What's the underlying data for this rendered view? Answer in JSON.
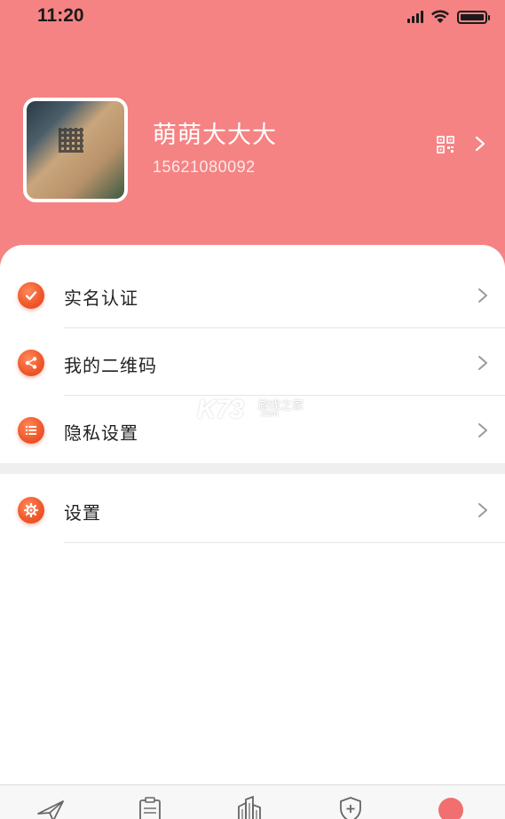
{
  "status_bar": {
    "time": "11:20",
    "icons": [
      "cellular-signal-icon",
      "wifi-icon",
      "battery-icon"
    ]
  },
  "theme": {
    "header_color": "#f58383",
    "accent_icon_color": "#f05a2c",
    "active_tab_color": "#f26f6f"
  },
  "profile": {
    "name": "萌萌大大大",
    "phone": "15621080092",
    "avatar_icon": "avatar",
    "qr_icon": "qr-code-icon",
    "chevron_icon": "chevron-right-icon"
  },
  "menu": {
    "group1": [
      {
        "label": "实名认证",
        "icon": "verified-check-icon"
      },
      {
        "label": "我的二维码",
        "icon": "share-icon"
      },
      {
        "label": "隐私设置",
        "icon": "list-icon"
      }
    ],
    "group2": [
      {
        "label": "设置",
        "icon": "gear-icon"
      }
    ]
  },
  "watermark": {
    "main": "K73",
    "sub1": "游戏之家",
    "sub2": ".com"
  },
  "tabbar": {
    "tabs": [
      {
        "icon": "paper-plane-icon",
        "active": false
      },
      {
        "icon": "clipboard-icon",
        "active": false
      },
      {
        "icon": "buildings-icon",
        "active": false
      },
      {
        "icon": "shield-plus-icon",
        "active": false
      },
      {
        "icon": "profile-dot-icon",
        "active": true
      }
    ]
  }
}
